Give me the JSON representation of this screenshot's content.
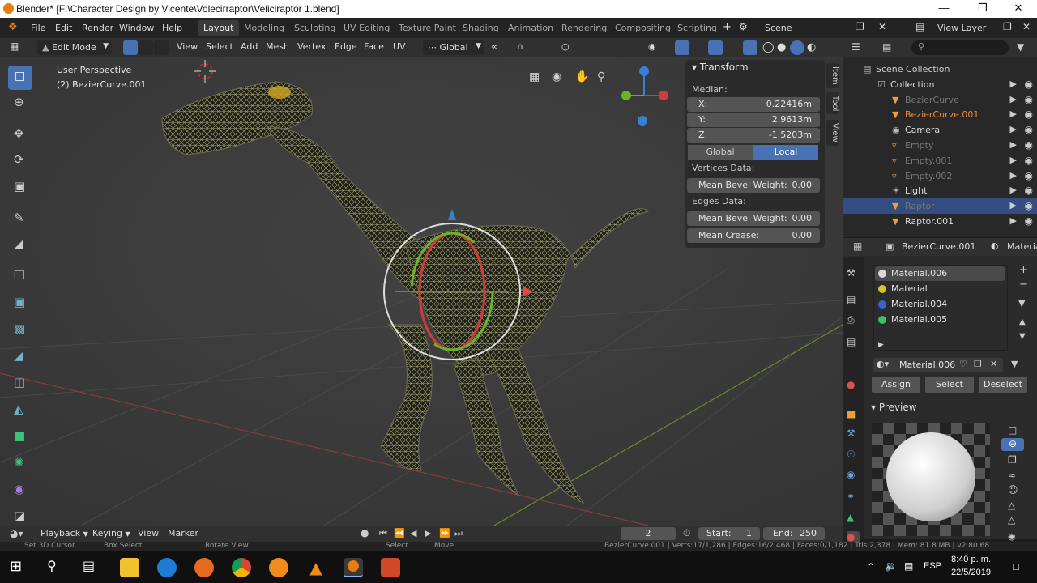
{
  "window": {
    "title": "Blender* [F:\\Character Design by Vicente\\Volecirraptor\\Veliciraptor 1.blend]"
  },
  "menu": [
    "File",
    "Edit",
    "Render",
    "Window",
    "Help"
  ],
  "workspaces": [
    "Layout",
    "Modeling",
    "Sculpting",
    "UV Editing",
    "Texture Paint",
    "Shading",
    "Animation",
    "Rendering",
    "Compositing",
    "Scripting"
  ],
  "scene": {
    "label": "Scene",
    "view_layer": "View Layer"
  },
  "header": {
    "mode": "Edit Mode",
    "menus": [
      "View",
      "Select",
      "Add",
      "Mesh",
      "Vertex",
      "Edge",
      "Face",
      "UV"
    ],
    "orientation": "Global"
  },
  "viewport": {
    "perspective": "User Perspective",
    "object": "(2) BezierCurve.001"
  },
  "npanel": {
    "title": "Transform",
    "median_label": "Median:",
    "x_label": "X:",
    "x_value": "0.22416m",
    "y_label": "Y:",
    "y_value": "2.9613m",
    "z_label": "Z:",
    "z_value": "-1.5203m",
    "global": "Global",
    "local": "Local",
    "vertices_data": "Vertices Data:",
    "mean_bevel_weight": "Mean Bevel Weight:",
    "mbw_v_value": "0.00",
    "edges_data": "Edges Data:",
    "mbw_e_value": "0.00",
    "mean_crease": "Mean Crease:",
    "mean_crease_value": "0.00",
    "tabs": [
      "Item",
      "Tool",
      "View"
    ]
  },
  "outliner": {
    "search_placeholder": "",
    "rows": [
      {
        "name": "Scene Collection",
        "indent": 0,
        "color": "#ccc"
      },
      {
        "name": "Collection",
        "indent": 1,
        "color": "#ddd"
      },
      {
        "name": "BezierCurve",
        "indent": 2,
        "color": "#777"
      },
      {
        "name": "BezierCurve.001",
        "indent": 2,
        "color": "#f28c32"
      },
      {
        "name": "Camera",
        "indent": 2,
        "color": "#ddd"
      },
      {
        "name": "Empty",
        "indent": 2,
        "color": "#777"
      },
      {
        "name": "Empty.001",
        "indent": 2,
        "color": "#777"
      },
      {
        "name": "Empty.002",
        "indent": 2,
        "color": "#777"
      },
      {
        "name": "Light",
        "indent": 2,
        "color": "#ddd"
      },
      {
        "name": "Raptor",
        "indent": 2,
        "color": "#777"
      },
      {
        "name": "Raptor.001",
        "indent": 2,
        "color": "#ddd"
      }
    ]
  },
  "properties": {
    "object": "BezierCurve.001",
    "tab_label": "Materia",
    "materials": [
      {
        "name": "Material.006",
        "color": "#d8d8d8"
      },
      {
        "name": "Material",
        "color": "#d4c42a"
      },
      {
        "name": "Material.004",
        "color": "#3a62d8"
      },
      {
        "name": "Material.005",
        "color": "#3cc25a"
      }
    ],
    "active_material": "Material.006",
    "assign": "Assign",
    "select": "Select",
    "deselect": "Deselect",
    "preview": "Preview"
  },
  "timeline": {
    "playback": "Playback",
    "keying": "Keying",
    "view": "View",
    "marker": "Marker",
    "current_frame": "2",
    "start_label": "Start:",
    "start": "1",
    "end_label": "End:",
    "end": "250"
  },
  "statusbar": {
    "left": [
      "Set 3D Cursor",
      "Box Select",
      "Rotate View",
      "Select",
      "Move"
    ],
    "right": "BezierCurve.001 | Verts:17/1,286 | Edges:16/2,468 | Faces:0/1,182 | Tris:2,378 | Mem: 81.8 MB | v2.80.68"
  },
  "taskbar": {
    "lang": "ESP",
    "time": "8:40 p. m.",
    "date": "22/5/2019"
  }
}
